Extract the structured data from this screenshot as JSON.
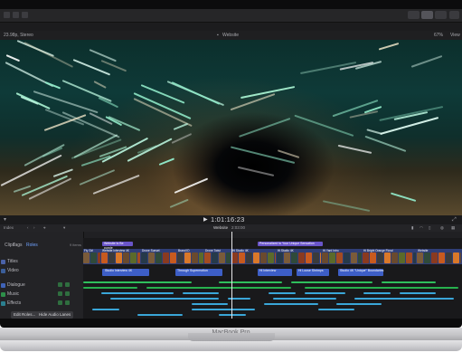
{
  "app": {
    "window_left_label": "23.98p, Stereo",
    "viewer_title": "Website",
    "zoom": "67%",
    "view_label": "View"
  },
  "viewer_controls": {
    "timecode": "1:01:16:23"
  },
  "timeline_toolbar": {
    "index_label": "Index",
    "project_name": "Website",
    "duration": "2:03:00",
    "clips_label": "Clips",
    "tags_label": "Tags",
    "roles_label": "Roles",
    "items_count": "9 items"
  },
  "sidebar": {
    "roles": [
      {
        "label": "Titles"
      },
      {
        "label": "Video"
      },
      {
        "label": "Dialogue"
      },
      {
        "label": "Music"
      },
      {
        "label": "Effects"
      }
    ],
    "edit_roles_button": "Edit Roles...",
    "hide_audio_lanes_button": "Hide Audio Lanes"
  },
  "timeline": {
    "title_clips": [
      "Website Is Be purple",
      "Personalized to Your Unique Sensation"
    ],
    "video_clips": [
      "Fly Girl",
      "Website Interview 4K",
      "Drone Sunset",
      "Brand ID",
      "Drone Twist",
      "Hi Studio 4K",
      "Hi Studio 4K",
      "Hi Yard Intro",
      "Hi Bright Orange Floral",
      "Website"
    ],
    "connected_clips": [
      "Studio Interview 4K",
      "Through Supermotion",
      "Hi Interview",
      "Hi Loose Shrimps",
      "Studio 4K \"Unique\" Boundaries"
    ]
  },
  "hardware": {
    "brand_label": "MacBook Pro"
  }
}
